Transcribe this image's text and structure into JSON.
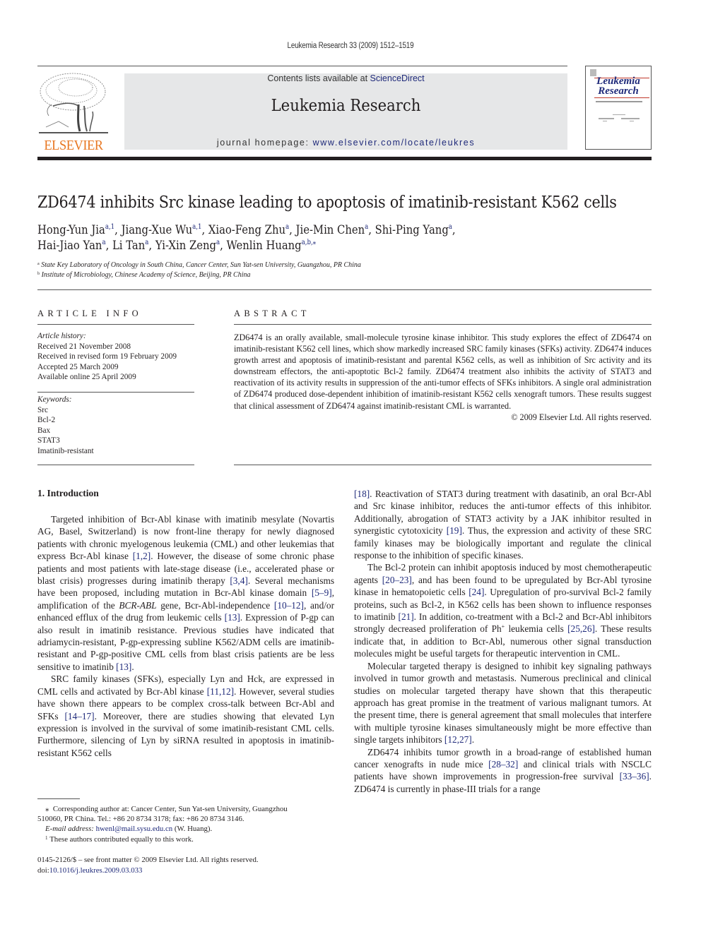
{
  "running_head": "Leukemia Research 33 (2009) 1512–1519",
  "masthead": {
    "contents_prefix": "Contents lists available at ",
    "contents_link": "ScienceDirect",
    "journal_title": "Leukemia Research",
    "homepage_prefix": "journal homepage: ",
    "homepage_link": "www.elsevier.com/locate/leukres",
    "publisher_logo_text": "ELSEVIER",
    "cover_title_line1": "Leukemia",
    "cover_title_line2": "Research"
  },
  "colors": {
    "link": "#1f2a7a",
    "elsevier_orange": "#e87722",
    "masthead_bg": "#e6e7e8",
    "text": "#231f20"
  },
  "article": {
    "title": "ZD6474 inhibits Src kinase leading to apoptosis of imatinib-resistant K562 cells",
    "authors": [
      {
        "name": "Hong-Yun Jia",
        "marks": "a,1",
        "sep": ", "
      },
      {
        "name": "Jiang-Xue Wu",
        "marks": "a,1",
        "sep": ", "
      },
      {
        "name": "Xiao-Feng Zhu",
        "marks": "a",
        "sep": ", "
      },
      {
        "name": "Jie-Min Chen",
        "marks": "a",
        "sep": ", "
      },
      {
        "name": "Shi-Ping Yang",
        "marks": "a",
        "sep": ","
      },
      {
        "name": "Hai-Jiao Yan",
        "marks": "a",
        "sep": ", "
      },
      {
        "name": "Li Tan",
        "marks": "a",
        "sep": ", "
      },
      {
        "name": "Yi-Xin Zeng",
        "marks": "a",
        "sep": ", "
      },
      {
        "name": "Wenlin Huang",
        "marks": "a,b,⁎",
        "sep": ""
      }
    ],
    "affiliations": [
      {
        "mark": "a",
        "text": "State Key Laboratory of Oncology in South China, Cancer Center, Sun Yat-sen University, Guangzhou, PR China"
      },
      {
        "mark": "b",
        "text": "Institute of Microbiology, Chinese Academy of Science, Beijing, PR China"
      }
    ]
  },
  "article_info": {
    "heading": "ARTICLE INFO",
    "history_label": "Article history:",
    "history": [
      "Received 21 November 2008",
      "Received in revised form 19 February 2009",
      "Accepted 25 March 2009",
      "Available online 25 April 2009"
    ],
    "keywords_label": "Keywords:",
    "keywords": [
      "Src",
      "Bcl-2",
      "Bax",
      "STAT3",
      "Imatinib-resistant"
    ]
  },
  "abstract": {
    "heading": "ABSTRACT",
    "text": "ZD6474 is an orally available, small-molecule tyrosine kinase inhibitor. This study explores the effect of ZD6474 on imatinib-resistant K562 cell lines, which show markedly increased SRC family kinases (SFKs) activity. ZD6474 induces growth arrest and apoptosis of imatinib-resistant and parental K562 cells, as well as inhibition of Src activity and its downstream effectors, the anti-apoptotic Bcl-2 family. ZD6474 treatment also inhibits the activity of STAT3 and reactivation of its activity results in suppression of the anti-tumor effects of SFKs inhibitors. A single oral administration of ZD6474 produced dose-dependent inhibition of imatinib-resistant K562 cells xenograft tumors. These results suggest that clinical assessment of ZD6474 against imatinib-resistant CML is warranted.",
    "copyright": "© 2009 Elsevier Ltd. All rights reserved."
  },
  "introduction": {
    "heading": "1.  Introduction",
    "left_paragraphs": [
      [
        {
          "t": "Targeted inhibition of Bcr-Abl kinase with imatinib mesylate (Novartis AG, Basel, Switzerland) is now front-line therapy for newly diagnosed patients with chronic myelogenous leukemia (CML) and other leukemias that express Bcr-Abl kinase "
        },
        {
          "c": "[1,2]"
        },
        {
          "t": ". How­ever, the disease of some chronic phase patients and most patients with late-stage disease (i.e., accelerated phase or blast crisis) pro­gresses during imatinib therapy "
        },
        {
          "c": "[3,4]"
        },
        {
          "t": ". Several mechanisms have been proposed, including mutation in Bcr-Abl kinase domain "
        },
        {
          "c": "[5–9]"
        },
        {
          "t": ", amplification of the "
        },
        {
          "i": "BCR-ABL"
        },
        {
          "t": " gene, Bcr-Abl-independence "
        },
        {
          "c": "[10–12]"
        },
        {
          "t": ", and/or enhanced efflux of the drug from leukemic cells "
        },
        {
          "c": "[13]"
        },
        {
          "t": ". Expres­sion of P-gp can also result in imatinib resistance. Previous studies have indicated that adriamycin-resistant, P-gp-expressing subline K562/ADM cells are imatinib-resistant and P-gp-positive CML cells from blast crisis patients are be less sensitive to imatinib "
        },
        {
          "c": "[13]"
        },
        {
          "t": "."
        }
      ],
      [
        {
          "t": "SRC family kinases (SFKs), especially Lyn and Hck, are expressed in CML cells and activated by Bcr-Abl kinase "
        },
        {
          "c": "[11,12]"
        },
        {
          "t": ". However, sev­eral studies have shown there appears to be complex cross-talk between Bcr-Abl and SFKs "
        },
        {
          "c": "[14–17]"
        },
        {
          "t": ". Moreover, there are studies showing that elevated Lyn expression is involved in the survival of some imatinib-resistant CML cells. Furthermore, silencing of Lyn by siRNA resulted in apoptosis in imatinib-resistant K562 cells"
        }
      ]
    ],
    "right_paragraphs": [
      [
        {
          "c": "[18]"
        },
        {
          "t": ". Reactivation of STAT3 during treatment with dasatinib, an oral Bcr-Abl and Src kinase inhibitor, reduces the anti-tumor effects of this inhibitor. Additionally, abrogation of STAT3 activity by a JAK inhibitor resulted in synergistic cytotoxicity "
        },
        {
          "c": "[19]"
        },
        {
          "t": ". Thus, the expres­sion and activity of these SRC family kinases may be biologically important and regulate the clinical response to the inhibition of specific kinases."
        }
      ],
      [
        {
          "t": "The Bcl-2 protein can inhibit apoptosis induced by most chemotherapeutic agents "
        },
        {
          "c": "[20–23]"
        },
        {
          "t": ", and has been found to be upreg­ulated by Bcr-Abl tyrosine kinase in hematopoietic cells "
        },
        {
          "c": "[24]"
        },
        {
          "t": ". Upregulation of pro-survival Bcl-2 family proteins, such as Bcl-2, in K562 cells has been shown to influence responses to imatinib "
        },
        {
          "c": "[21]"
        },
        {
          "t": ". In addition, co-treatment with a Bcl-2 and Bcr-Abl inhibitors strongly decreased proliferation of Ph"
        },
        {
          "s": "+"
        },
        {
          "t": " leukemia cells "
        },
        {
          "c": "[25,26]"
        },
        {
          "t": ". These results indicate that, in addition to Bcr-Abl, numerous other sig­nal transduction molecules might be useful targets for therapeutic intervention in CML."
        }
      ],
      [
        {
          "t": "Molecular targeted therapy is designed to inhibit key signaling pathways involved in tumor growth and metastasis. Numerous pre­clinical and clinical studies on molecular targeted therapy have shown that this therapeutic approach has great promise in the treatment of various malignant tumors. At the present time, there is general agreement that small molecules that interfere with mul­tiple tyrosine kinases simultaneously might be more effective than single targets inhibitors "
        },
        {
          "c": "[12,27]"
        },
        {
          "t": "."
        }
      ],
      [
        {
          "t": "ZD6474 inhibits tumor growth in a broad-range of established human cancer xenografts in nude mice "
        },
        {
          "c": "[28–32]"
        },
        {
          "t": " and clinical trials with NSCLC patients have shown improvements in progression-free survival "
        },
        {
          "c": "[33–36]"
        },
        {
          "t": ". ZD6474 is currently in phase-III trials for a range"
        }
      ]
    ]
  },
  "footnotes": {
    "corresponding_mark": "⁎",
    "corresponding_line1": "Corresponding author at: Cancer Center, Sun Yat-sen University, Guangzhou",
    "corresponding_line2": "510060, PR China. Tel.: +86 20 8734 3178; fax: +86 20 8734 3146.",
    "email_label": "E-mail address:",
    "email": "hwenl@mail.sysu.edu.cn",
    "email_suffix": " (W. Huang).",
    "equal_mark": "1",
    "equal_text": "These authors contributed equally to this work."
  },
  "imprint": {
    "issn_line": "0145-2126/$ – see front matter © 2009 Elsevier Ltd. All rights reserved.",
    "doi_prefix": "doi:",
    "doi": "10.1016/j.leukres.2009.03.033"
  }
}
